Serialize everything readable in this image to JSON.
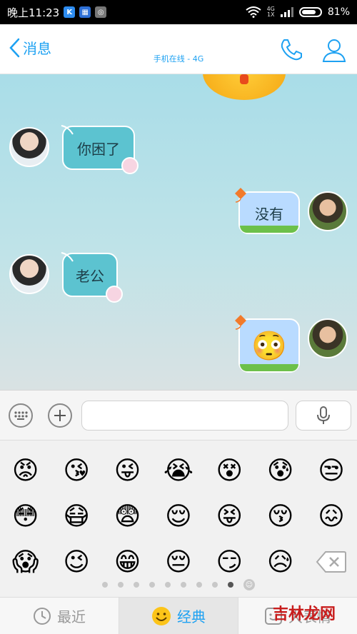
{
  "status_bar": {
    "time": "晚上11:23",
    "network_top": "4G",
    "network_bottom": "1X",
    "battery": "81%",
    "battery_level": 0.81,
    "app_icons": [
      "k-app-icon",
      "weibo-app-icon",
      "security-app-icon"
    ]
  },
  "header": {
    "back_label": "消息",
    "status": "手机在线 - 4G",
    "icons": [
      "phone-icon",
      "profile-icon"
    ]
  },
  "messages": [
    {
      "side": "left",
      "text": "你困了"
    },
    {
      "side": "right",
      "text": "没有"
    },
    {
      "side": "left",
      "text": "老公"
    },
    {
      "side": "right",
      "text": "😳"
    }
  ],
  "input": {
    "placeholder": "",
    "value": ""
  },
  "emoji_panel": {
    "rows": [
      [
        "😡",
        "😘",
        "😜",
        "😭",
        "😵",
        "😰",
        "😒"
      ],
      [
        "😳",
        "😷",
        "😨",
        "😌",
        "😝",
        "😚",
        "😖"
      ],
      [
        "😱",
        "😉",
        "😁",
        "😔",
        "😏",
        "😥"
      ]
    ],
    "pages": 10,
    "active_page": 9
  },
  "tabs": [
    {
      "label": "最近",
      "icon": "clock-icon"
    },
    {
      "label": "经典",
      "icon": "smiley-icon"
    },
    {
      "label": "大表情",
      "icon": "big-emoji-icon"
    }
  ],
  "watermark": "吉林龙网",
  "colors": {
    "accent": "#1da1f2",
    "left_bubble": "#5cc3d0",
    "right_bubble": "#b9dbff"
  }
}
